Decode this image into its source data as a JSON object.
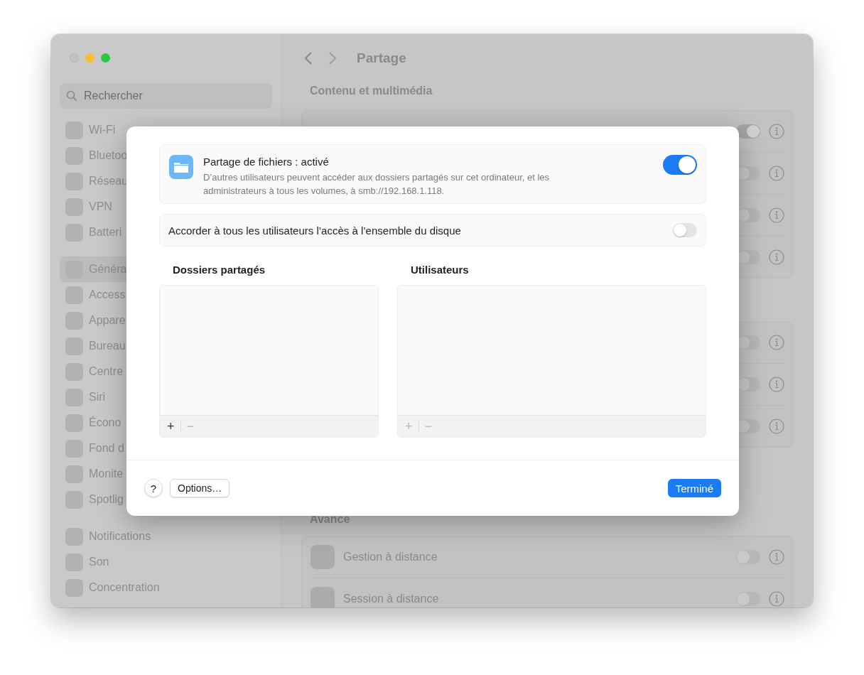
{
  "sidebar": {
    "search": {
      "placeholder": "Rechercher"
    },
    "groups": [
      {
        "items": [
          {
            "label": "Wi-Fi",
            "selected": false
          },
          {
            "label": "Bluetoo",
            "selected": false
          },
          {
            "label": "Réseau",
            "selected": false
          },
          {
            "label": "VPN",
            "selected": false
          },
          {
            "label": "Batteri",
            "selected": false
          }
        ]
      },
      {
        "items": [
          {
            "label": "Généra",
            "selected": true
          },
          {
            "label": "Access",
            "selected": false
          },
          {
            "label": "Appare",
            "selected": false
          },
          {
            "label": "Bureau",
            "selected": false
          },
          {
            "label": "Centre",
            "selected": false
          },
          {
            "label": "Siri",
            "selected": false
          },
          {
            "label": "Écono",
            "selected": false
          },
          {
            "label": "Fond d",
            "selected": false
          },
          {
            "label": "Monite",
            "selected": false
          },
          {
            "label": "Spotlig",
            "selected": false
          }
        ]
      },
      {
        "items": [
          {
            "label": "Notifications",
            "selected": false
          },
          {
            "label": "Son",
            "selected": false
          },
          {
            "label": "Concentration",
            "selected": false
          }
        ]
      }
    ]
  },
  "content": {
    "title": "Partage",
    "sections": [
      {
        "heading": "Contenu et multimédia",
        "rows": [
          {
            "on": true
          },
          {
            "on": false
          },
          {
            "on": false
          },
          {
            "on": false
          }
        ]
      },
      {
        "rows": [
          {
            "on": false
          },
          {
            "on": false
          },
          {
            "on": false
          }
        ]
      },
      {
        "heading": "Avance",
        "rows": [
          {
            "label": "Gestion à distance",
            "on": false
          },
          {
            "label": "Session à distance",
            "on": false
          }
        ]
      }
    ]
  },
  "sheet": {
    "service": {
      "title": "Partage de fichiers : activé",
      "description": "D’autres utilisateurs peuvent accéder aux dossiers partagés sur cet ordinateur, et les administrateurs à tous les volumes, à smb://192.168.1.118.",
      "on": true
    },
    "full_disk": {
      "label": "Accorder à tous les utilisateurs l’accès à l’ensemble du disque",
      "on": false
    },
    "lists": [
      {
        "heading": "Dossiers partagés",
        "add": "+",
        "add_disabled": false,
        "remove": "−",
        "remove_disabled": true
      },
      {
        "heading": "Utilisateurs",
        "add": "+",
        "add_disabled": true,
        "remove": "−",
        "remove_disabled": true
      }
    ],
    "help": "?",
    "options": "Options…",
    "done": "Terminé"
  }
}
